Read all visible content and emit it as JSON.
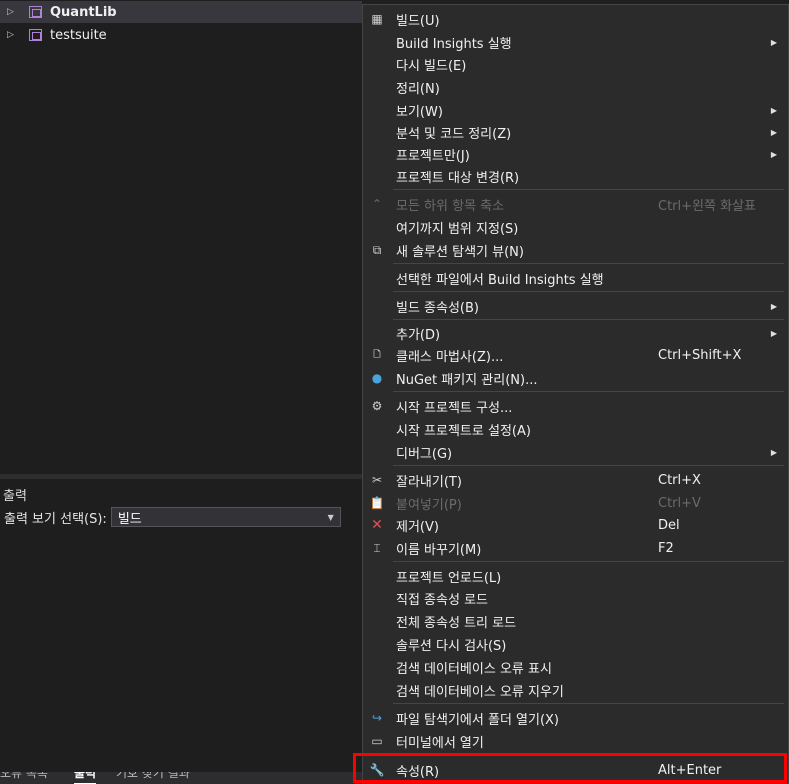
{
  "solution_tree": {
    "items": [
      {
        "label": "QuantLib",
        "selected": true,
        "icon": "project-icon"
      },
      {
        "label": "testsuite",
        "selected": false,
        "icon": "project-icon"
      }
    ]
  },
  "output_panel": {
    "title": "출력",
    "select_label": "출력 보기 선택(S):",
    "select_value": "빌드",
    "tabs": [
      {
        "label": "오류 목록",
        "active": false
      },
      {
        "label": "출력",
        "active": true
      },
      {
        "label": "기호 찾기 결과",
        "active": false
      }
    ]
  },
  "context_menu": {
    "items": [
      {
        "label": "빌드(U)",
        "icon": "build-icon"
      },
      {
        "label": "Build Insights 실행",
        "submenu": true
      },
      {
        "label": "다시 빌드(E)"
      },
      {
        "label": "정리(N)"
      },
      {
        "label": "보기(W)",
        "submenu": true
      },
      {
        "label": "분석 및 코드 정리(Z)",
        "submenu": true
      },
      {
        "label": "프로젝트만(J)",
        "submenu": true
      },
      {
        "label": "프로젝트 대상 변경(R)"
      },
      {
        "label": "모든 하위 항목 축소",
        "shortcut": "Ctrl+왼쪽 화살표",
        "disabled": true,
        "icon": "collapse-icon"
      },
      {
        "label": "여기까지 범위 지정(S)"
      },
      {
        "label": "새 솔루션 탐색기 뷰(N)",
        "icon": "new-view-icon"
      },
      {
        "label": "선택한 파일에서 Build Insights 실행"
      },
      {
        "label": "빌드 종속성(B)",
        "submenu": true
      },
      {
        "label": "추가(D)",
        "submenu": true
      },
      {
        "label": "클래스 마법사(Z)...",
        "shortcut": "Ctrl+Shift+X",
        "icon": "class-wizard-icon"
      },
      {
        "label": "NuGet 패키지 관리(N)...",
        "icon": "nuget-icon"
      },
      {
        "label": "시작 프로젝트 구성...",
        "icon": "gear-icon"
      },
      {
        "label": "시작 프로젝트로 설정(A)"
      },
      {
        "label": "디버그(G)",
        "submenu": true
      },
      {
        "label": "잘라내기(T)",
        "shortcut": "Ctrl+X",
        "icon": "scissors-icon"
      },
      {
        "label": "붙여넣기(P)",
        "shortcut": "Ctrl+V",
        "disabled": true,
        "icon": "paste-icon"
      },
      {
        "label": "제거(V)",
        "shortcut": "Del",
        "icon": "delete-icon"
      },
      {
        "label": "이름 바꾸기(M)",
        "shortcut": "F2",
        "icon": "rename-icon"
      },
      {
        "label": "프로젝트 언로드(L)"
      },
      {
        "label": "직접 종속성 로드"
      },
      {
        "label": "전체 종속성 트리 로드"
      },
      {
        "label": "솔루션 다시 검사(S)"
      },
      {
        "label": "검색 데이터베이스 오류 표시"
      },
      {
        "label": "검색 데이터베이스 오류 지우기"
      },
      {
        "label": "파일 탐색기에서 폴더 열기(X)",
        "icon": "open-folder-icon"
      },
      {
        "label": "터미널에서 열기",
        "icon": "terminal-icon"
      },
      {
        "label": "속성(R)",
        "shortcut": "Alt+Enter",
        "icon": "wrench-icon",
        "highlighted": true
      }
    ]
  },
  "colors": {
    "highlight_border": "#ff0000",
    "menu_bg": "#2b2b2b",
    "delete_icon": "#e05252",
    "open_folder_icon": "#4aa3df"
  }
}
